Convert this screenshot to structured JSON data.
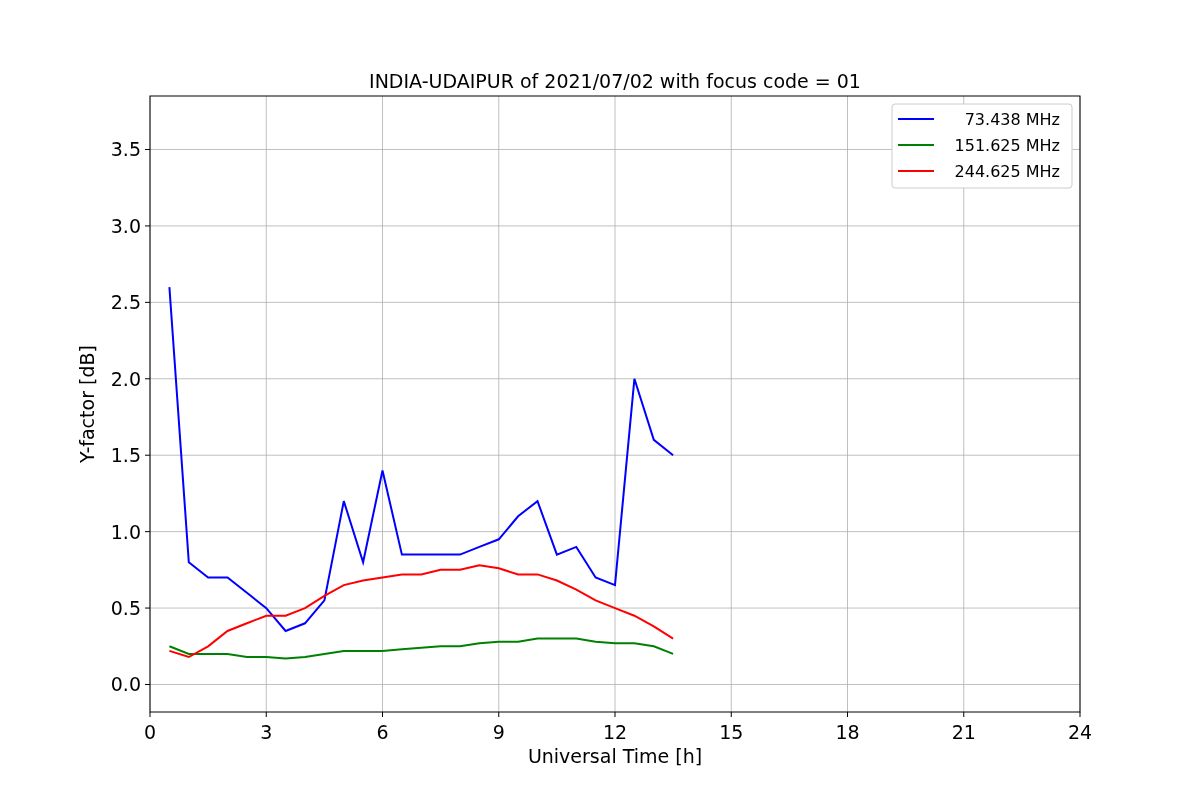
{
  "chart_data": {
    "type": "line",
    "title": "INDIA-UDAIPUR of 2021/07/02 with focus code = 01",
    "xlabel": "Universal Time [h]",
    "ylabel": "Y-factor [dB]",
    "x": [
      0.5,
      1,
      1.5,
      2,
      2.5,
      3,
      3.5,
      4,
      4.5,
      5,
      5.5,
      6,
      6.5,
      7,
      7.5,
      8,
      8.5,
      9,
      9.5,
      10,
      10.5,
      11,
      11.5,
      12,
      12.5,
      13,
      13.5
    ],
    "series": [
      {
        "name": "73.438 MHz",
        "color": "#0000ff",
        "values": [
          2.6,
          0.8,
          0.7,
          0.7,
          0.6,
          0.5,
          0.35,
          0.4,
          0.55,
          1.2,
          0.8,
          1.4,
          0.85,
          0.85,
          0.85,
          0.85,
          0.9,
          0.95,
          1.1,
          1.2,
          0.85,
          0.9,
          0.7,
          0.65,
          2.0,
          1.6,
          1.5
        ]
      },
      {
        "name": "151.625 MHz",
        "color": "#008000",
        "values": [
          0.25,
          0.2,
          0.2,
          0.2,
          0.18,
          0.18,
          0.17,
          0.18,
          0.2,
          0.22,
          0.22,
          0.22,
          0.23,
          0.24,
          0.25,
          0.25,
          0.27,
          0.28,
          0.28,
          0.3,
          0.3,
          0.3,
          0.28,
          0.27,
          0.27,
          0.25,
          0.2
        ]
      },
      {
        "name": "244.625 MHz",
        "color": "#ff0000",
        "values": [
          0.22,
          0.18,
          0.25,
          0.35,
          0.4,
          0.45,
          0.45,
          0.5,
          0.58,
          0.65,
          0.68,
          0.7,
          0.72,
          0.72,
          0.75,
          0.75,
          0.78,
          0.76,
          0.72,
          0.72,
          0.68,
          0.62,
          0.55,
          0.5,
          0.45,
          0.38,
          0.3
        ]
      }
    ],
    "grid": true,
    "legend": true,
    "xlim": [
      0,
      24
    ],
    "ylim": [
      -0.18,
      3.85
    ],
    "xticks": [
      0,
      3,
      6,
      9,
      12,
      15,
      18,
      21,
      24
    ],
    "yticks": [
      {
        "value": 0,
        "label": "0.0"
      },
      {
        "value": 0.5,
        "label": "0.5"
      },
      {
        "value": 1,
        "label": "1.0"
      },
      {
        "value": 1.5,
        "label": "1.5"
      },
      {
        "value": 2,
        "label": "2.0"
      },
      {
        "value": 2.5,
        "label": "2.5"
      },
      {
        "value": 3,
        "label": "3.0"
      },
      {
        "value": 3.5,
        "label": "3.5"
      }
    ]
  }
}
